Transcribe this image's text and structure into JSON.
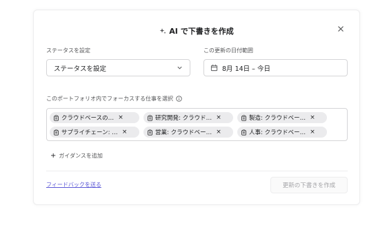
{
  "dialog": {
    "title": "AI で下書きを作成",
    "close_symbol": "×"
  },
  "status": {
    "label": "ステータスを設定",
    "selected_value": "ステータスを設定"
  },
  "date_range": {
    "label": "この更新の日付範囲",
    "value": "8月 14日 – 今日"
  },
  "focus": {
    "label": "このポートフォリオ内でフォーカスする仕事を選択",
    "chips": [
      {
        "text": "クラウドベースの…"
      },
      {
        "text": "研究開発: クラウド…"
      },
      {
        "text": "製造: クラウドベー…"
      },
      {
        "text": "サプライチェーン: …"
      },
      {
        "text": "営業: クラウドベー…"
      },
      {
        "text": "人事: クラウドベー…"
      }
    ],
    "remove_symbol": "×"
  },
  "guidance": {
    "plus": "+",
    "label": "ガイダンスを追加"
  },
  "footer": {
    "feedback_link": "フィードバックを送る",
    "submit_label": "更新の下書きを作成"
  },
  "icons": {
    "sparkle": "sparkle-icon",
    "close": "close-icon",
    "chevron": "chevron-down-icon",
    "calendar": "calendar-icon",
    "info": "info-icon",
    "clipboard": "clipboard-icon"
  },
  "colors": {
    "link": "#5b57d6",
    "chip_bg": "#ebebed",
    "disabled_text": "#a3a3a6"
  }
}
